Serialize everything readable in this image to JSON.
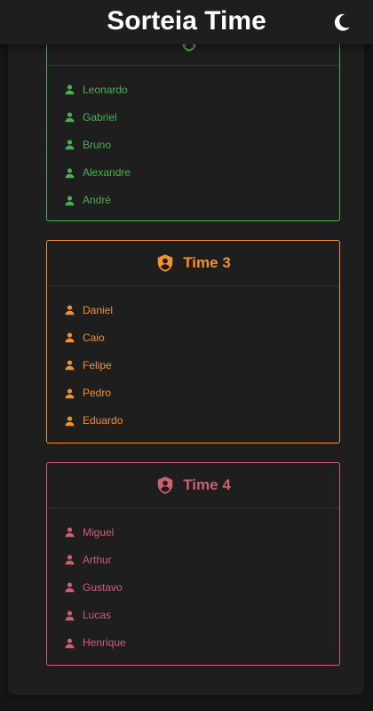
{
  "app": {
    "title": "Sorteia Time",
    "theme_icon": "moon-icon"
  },
  "teams": [
    {
      "name": "",
      "color": "#4caf50",
      "icon": "shield-icon",
      "players": [
        "Leonardo",
        "Gabriel",
        "Bruno",
        "Alexandre",
        "André"
      ]
    },
    {
      "name": "Time 3",
      "color": "#f0922f",
      "icon": "shield-icon",
      "players": [
        "Daniel",
        "Caio",
        "Felipe",
        "Pedro",
        "Eduardo"
      ]
    },
    {
      "name": "Time 4",
      "color": "#cc5f70",
      "icon": "shield-icon",
      "players": [
        "Miguel",
        "Arthur",
        "Gustavo",
        "Lucas",
        "Henrique"
      ]
    }
  ]
}
